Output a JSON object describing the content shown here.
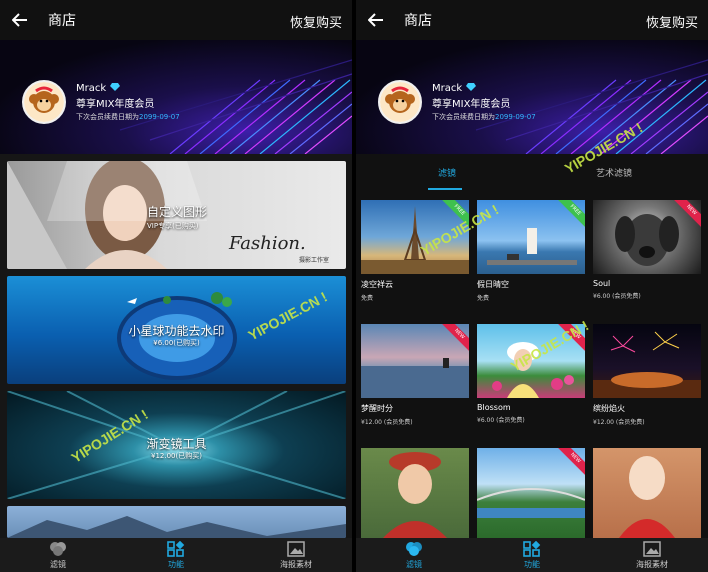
{
  "topbar": {
    "title": "商店",
    "restore_label": "恢复购买"
  },
  "profile": {
    "name": "Mrack",
    "tier": "尊享MIX年度会员",
    "renew_prefix": "下次会员续费日期为",
    "renew_date": "2099-09-07",
    "icons": {
      "avatar": "monkey-avatar",
      "badge": "diamond-icon"
    }
  },
  "left_cards": [
    {
      "title": "自定义图形",
      "price": "VIP专享(已购买)",
      "caption_script": "Fashion.",
      "caption_small": "摄影工作室"
    },
    {
      "title": "小星球功能去水印",
      "price": "¥6.00(已购买)"
    },
    {
      "title": "渐变镜工具",
      "price": "¥12.00(已购买)"
    }
  ],
  "tabs": {
    "active": "滤镜",
    "inactive": "艺术滤镜"
  },
  "filters": [
    {
      "name": "凌空祥云",
      "price": "免费",
      "ribbon": "FREE"
    },
    {
      "name": "假日晴空",
      "price": "免费",
      "ribbon": "FREE"
    },
    {
      "name": "Soul",
      "price": "¥6.00 (会员免费)",
      "ribbon": "NEW"
    },
    {
      "name": "梦醒时分",
      "price": "¥12.00 (会员免费)",
      "ribbon": "NEW"
    },
    {
      "name": "Blossom",
      "price": "¥6.00 (会员免费)",
      "ribbon": "NEW"
    },
    {
      "name": "缤纷焰火",
      "price": "¥12.00 (会员免费)",
      "ribbon": ""
    },
    {
      "name": "",
      "price": "",
      "ribbon": ""
    },
    {
      "name": "",
      "price": "",
      "ribbon": "NEW"
    },
    {
      "name": "",
      "price": "",
      "ribbon": ""
    }
  ],
  "nav": {
    "filters": "滤镜",
    "features": "功能",
    "poster": "海报素材"
  },
  "watermark": "YIPOJIE.CN !",
  "colors": {
    "accent": "#21a9e0",
    "free": "#3ec14e",
    "new": "#e0234b",
    "date": "#34b7ff",
    "watermark": "#c8e646"
  }
}
